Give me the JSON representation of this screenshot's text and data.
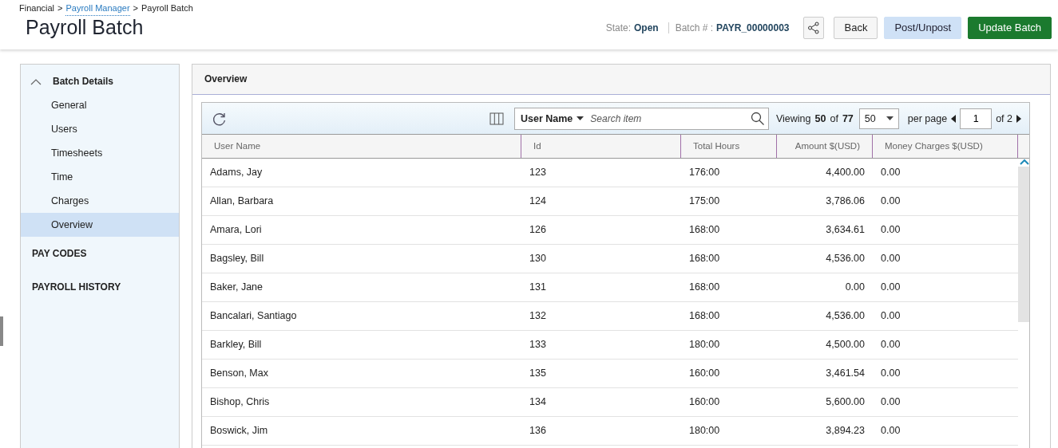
{
  "breadcrumb": [
    {
      "label": "Financial",
      "link": false
    },
    {
      "label": "Payroll Manager",
      "link": true
    },
    {
      "label": "Payroll Batch",
      "link": false
    }
  ],
  "breadcrumb_separator": ">",
  "page_title": "Payroll Batch",
  "state": {
    "label": "State:",
    "value": "Open"
  },
  "batch": {
    "label": "Batch # :",
    "value": "PAYR_00000003"
  },
  "buttons": [
    {
      "label": "Back",
      "kind": "default"
    },
    {
      "label": "Post/Unpost",
      "kind": "light"
    },
    {
      "label": "Update Batch",
      "kind": "primary"
    }
  ],
  "sidebar": {
    "sections": [
      {
        "label": "Batch Details",
        "expanded": true,
        "children": [
          {
            "label": "General",
            "selected": false
          },
          {
            "label": "Users",
            "selected": false
          },
          {
            "label": "Timesheets",
            "selected": false
          },
          {
            "label": "Time",
            "selected": false
          },
          {
            "label": "Charges",
            "selected": false
          },
          {
            "label": "Overview",
            "selected": true
          }
        ]
      },
      {
        "label": "PAY CODES"
      },
      {
        "label": "PAYROLL HISTORY"
      }
    ]
  },
  "panel_title": "Overview",
  "toolbar": {
    "search_field": "User Name",
    "search_placeholder": "Search item",
    "viewing_label": "Viewing",
    "viewing_count": "50",
    "of_label": "of",
    "total": "77",
    "page_size": "50",
    "per_page": "per page",
    "page": "1",
    "of_pages": "of 2"
  },
  "table": {
    "columns": [
      "User Name",
      "Id",
      "Total Hours",
      "Amount $(USD)",
      "Money Charges $(USD)"
    ],
    "rows": [
      [
        "Adams, Jay",
        "123",
        "176:00",
        "4,400.00",
        "0.00"
      ],
      [
        "Allan, Barbara",
        "124",
        "175:00",
        "3,786.06",
        "0.00"
      ],
      [
        "Amara, Lori",
        "126",
        "168:00",
        "3,634.61",
        "0.00"
      ],
      [
        "Bagsley, Bill",
        "130",
        "168:00",
        "4,536.00",
        "0.00"
      ],
      [
        "Baker, Jane",
        "131",
        "168:00",
        "0.00",
        "0.00"
      ],
      [
        "Bancalari, Santiago",
        "132",
        "168:00",
        "4,536.00",
        "0.00"
      ],
      [
        "Barkley, Bill",
        "133",
        "180:00",
        "4,500.00",
        "0.00"
      ],
      [
        "Benson, Max",
        "135",
        "160:00",
        "3,461.54",
        "0.00"
      ],
      [
        "Bishop, Chris",
        "134",
        "160:00",
        "5,600.00",
        "0.00"
      ],
      [
        "Boswick, Jim",
        "136",
        "180:00",
        "3,894.23",
        "0.00"
      ]
    ]
  }
}
